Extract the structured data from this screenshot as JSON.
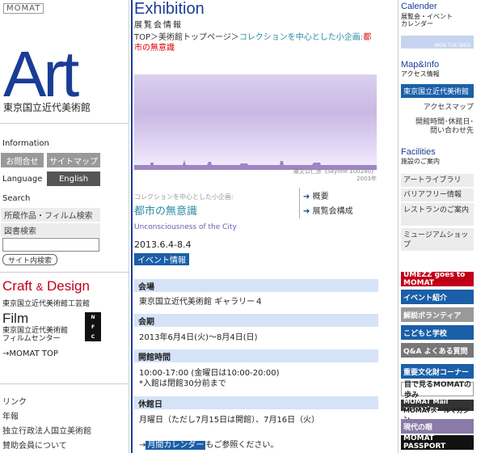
{
  "left": {
    "logo": "MOMAT",
    "art": "Art",
    "art_sub": "東京国立近代美術館",
    "information_label": "Information",
    "contact_button": "お問合せ",
    "sitemap_button": "サイトマップ",
    "language_label": "Language",
    "english_button": "English",
    "search_label": "Search",
    "search_items": [
      "所蔵作品・フィルム検索",
      "図書検索"
    ],
    "search_button": "サイト内検索",
    "craft": "Craft",
    "craft_amp": "&",
    "craft_design": "Design",
    "craft_sub": "東京国立近代美術館工芸館",
    "film": "Film",
    "film_sub_1": "東京国立近代美術館",
    "film_sub_2": "フィルムセンター",
    "nfc": [
      "N",
      "F",
      "C"
    ],
    "momat_top": "→MOMAT TOP",
    "links": [
      "リンク",
      "年報",
      "独立行政法人国立美術館",
      "賛助会員について"
    ]
  },
  "main": {
    "title": "Exhibition",
    "subtitle": "展覧会情報",
    "breadcrumb_top": "TOP＞美術館トップページ＞",
    "breadcrumb_current": "コレクションを中心とした小企画:",
    "breadcrumb_red": "都市の無意識",
    "caption_1": "藤文公仁彦《Skyline 100280》",
    "caption_2": "2003年",
    "collection_sub": "コレクションを中心とした小企画:",
    "collection_title": "都市の無意識",
    "collection_en": "Unconsciousness of the City",
    "side_links": [
      "概要",
      "展覧会構成"
    ],
    "period": "2013.6.4-8.4",
    "event_button": "イベント情報",
    "sections": [
      {
        "head": "会場",
        "lines": [
          "東京国立近代美術館 ギャラリー４"
        ]
      },
      {
        "head": "会期",
        "lines": [
          "2013年6月4日(火)～8月4日(日)"
        ]
      },
      {
        "head": "開館時間",
        "lines": [
          "10:00-17:00 (金曜日は10:00-20:00)",
          "*入館は閉館30分前まで"
        ]
      },
      {
        "head": "休館日",
        "lines": [
          "月曜日（ただし7月15日は開館）、7月16日（火）"
        ]
      }
    ],
    "calendar_arrow": "→",
    "calendar_button": "月間カレンダー",
    "calendar_suffix": "もご参照ください。"
  },
  "right": {
    "calendar_title": "Calender",
    "calendar_sub_1": "展覧会・イベント",
    "calendar_sub_2": "カレンダー",
    "calendar_img": "MON TUE WED",
    "map_title": "Map&Info",
    "map_sub": "アクセス情報",
    "museum_button": "東京国立近代美術館",
    "access_map": "アクセスマップ",
    "hours_1": "開館時間･休館日･",
    "hours_2": "問い合わせ先",
    "facilities_title": "Facilities",
    "facilities_sub": "施設のご案内",
    "facility_items": [
      "アートライブラリ",
      "バリアフリー情報",
      "レストランのご案内",
      "ミュージアムショップ"
    ],
    "banners": [
      {
        "label": "UMEZZ goes to MOMAT",
        "color": "#c00018"
      },
      {
        "label": "イベント紹介",
        "color": "#1a5fa8"
      },
      {
        "label": "解説ボランティア",
        "color": "#999999"
      },
      {
        "label": "こどもと学校",
        "color": "#1a5fa8"
      },
      {
        "label": "Q&A よくある質問",
        "color": "#777777"
      },
      {
        "label": "重要文化財コーナー",
        "color": "#1a5fa8"
      },
      {
        "label": "目で見るMOMATの歩み",
        "color": "#ffffff"
      },
      {
        "label": "MOMAT Mail magazine",
        "color": "#333333"
      },
      {
        "label": "MOMATメールマガジン",
        "color": "#ffffff"
      },
      {
        "label": "現代の眼",
        "color": "#8a7aa8"
      },
      {
        "label": "MOMAT PASSPORT",
        "color": "#111111"
      }
    ]
  }
}
